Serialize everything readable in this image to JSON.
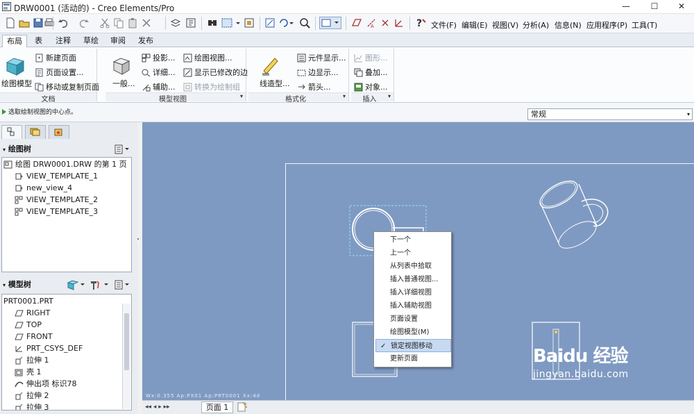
{
  "window": {
    "title": "DRW0001 (活动的) - Creo Elements/Pro",
    "min": "—",
    "max": "☐",
    "close": "✕"
  },
  "menus": [
    "文件(F)",
    "编辑(E)",
    "视图(V)",
    "分析(A)",
    "信息(N)",
    "应用程序(P)",
    "工具(T)"
  ],
  "tabs": [
    "布局",
    "表",
    "注释",
    "草绘",
    "审阅",
    "发布"
  ],
  "ribbon": {
    "doc": {
      "big": "绘图模型",
      "new_page": "新建页面",
      "page_setup": "页面设置...",
      "move_copy": "移动或复制页面",
      "label": "文档"
    },
    "model_views": {
      "big": "一般...",
      "projection": "投影...",
      "detail": "详细...",
      "aux": "辅助...",
      "drawing_view": "绘图视图...",
      "show_modified": "显示已修改的边",
      "convert": "转换为绘制组",
      "label": "模型视图"
    },
    "format": {
      "big": "线造型...",
      "element_display": "元件显示...",
      "edge_display": "边显示...",
      "arrow": "箭头...",
      "label": "格式化"
    },
    "insert": {
      "graphics": "图形...",
      "overlay": "叠加...",
      "object": "对象...",
      "label": "插入"
    }
  },
  "prompt": "选取绘制视图的中心点。",
  "filter_value": "常规",
  "drawing_tree": {
    "title": "绘图树",
    "items": [
      "绘图 DRW0001.DRW 的第 1 页",
      "VIEW_TEMPLATE_1",
      "new_view_4",
      "VIEW_TEMPLATE_2",
      "VIEW_TEMPLATE_3"
    ]
  },
  "model_tree": {
    "title": "模型树",
    "items": [
      "PRT0001.PRT",
      "RIGHT",
      "TOP",
      "FRONT",
      "PRT_CSYS_DEF",
      "拉伸 1",
      "壳 1",
      "伸出项 标识78",
      "拉伸 2",
      "拉伸 3"
    ]
  },
  "context_menu": {
    "items": [
      "下一个",
      "上一个",
      "从列表中拾取",
      "插入普通视图...",
      "插入详细视图",
      "插入辅助视图",
      "页面设置",
      "绘图模型(M)",
      "锁定视图移动",
      "更新页面"
    ],
    "checked_index": 8,
    "check_mark": "✓"
  },
  "bottom": {
    "page_tab": "页面 1",
    "nav": "◂◂ ◂ ▸ ▸▸"
  },
  "coords": "Wx:0.355  Ap:PX01  Ap:PRT0001  Xx:4d",
  "watermark": {
    "brand": "Baidu 经验",
    "url": "jingyan.baidu.com"
  },
  "colors": {
    "canvas": "#7f9ac2",
    "ribbon_bg": "#fbfcfd",
    "selection": "#c7daf2"
  }
}
